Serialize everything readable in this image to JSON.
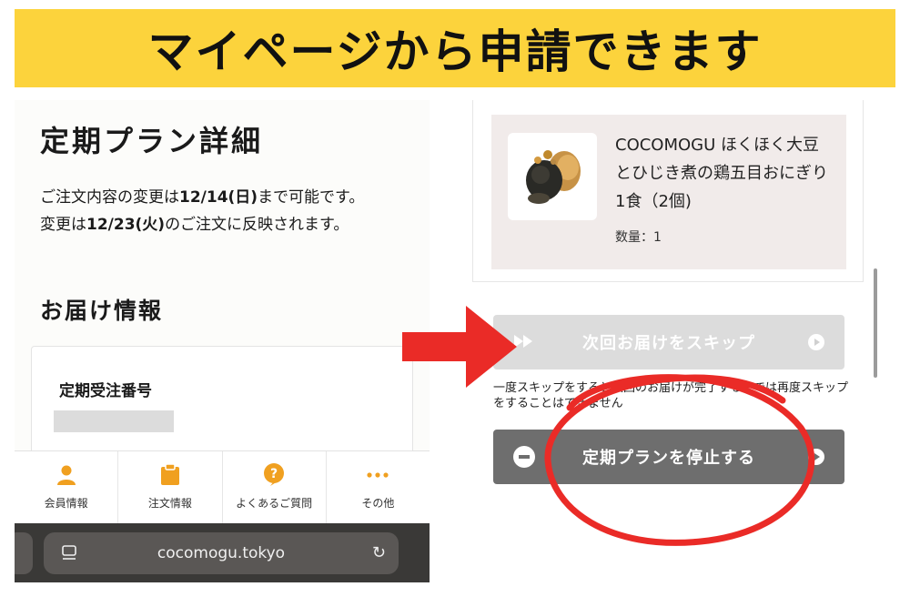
{
  "banner": {
    "title": "マイページから申請できます",
    "color": "#fcd33c"
  },
  "left": {
    "plan_title": "定期プラン詳細",
    "note": {
      "part1": "ご注文内容の変更は",
      "date1": "12/14(日)",
      "part2": "まで可能です。",
      "part3": "変更は",
      "date2": "12/23(火)",
      "part4": "のご注文に反映されます。"
    },
    "delivery_title": "お届け情報",
    "order_number_label": "定期受注番号",
    "nav": [
      {
        "label": "会員情報",
        "icon": "person-icon"
      },
      {
        "label": "注文情報",
        "icon": "clipboard-icon"
      },
      {
        "label": "よくあるご質問",
        "icon": "question-icon"
      },
      {
        "label": "その他",
        "icon": "more-icon"
      }
    ],
    "browser_url": "cocomogu.tokyo",
    "accent_color": "#f0a020"
  },
  "right": {
    "product_name": "COCOMOGU ほくほく大豆とひじき煮の鶏五目おにぎり 1食（2個)",
    "product_qty": "数量：1",
    "skip_button": "次回お届けをスキップ",
    "skip_note": "一度スキップをすると次回のお届けが完了するまでは再度スキップをすることはできません",
    "stop_button": "定期プランを停止する",
    "annotation_color": "#ea2b27"
  }
}
